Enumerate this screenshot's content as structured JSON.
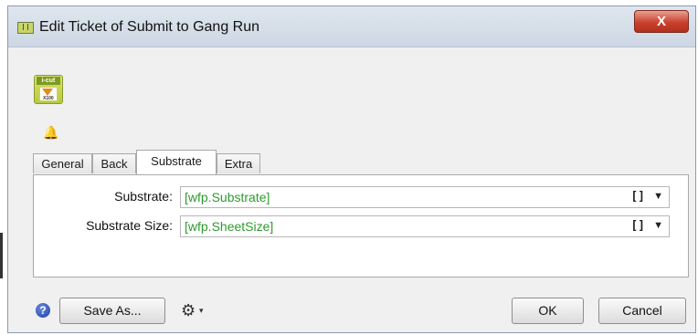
{
  "window": {
    "title": "Edit Ticket of Submit to Gang Run",
    "close_label": "X"
  },
  "app_icon": {
    "name": "i-cut-x100-icon",
    "top_text": "i-cut",
    "bottom_text": "X100"
  },
  "bell": {
    "name": "bell-icon",
    "glyph": "🔔"
  },
  "tabs": [
    {
      "label": "General",
      "active": false
    },
    {
      "label": "Back",
      "active": false
    },
    {
      "label": "Substrate",
      "active": true
    },
    {
      "label": "Extra",
      "active": false
    }
  ],
  "fields": [
    {
      "label": "Substrate:",
      "value": "[wfp.Substrate]",
      "brackets": "[]",
      "arrow": "▼"
    },
    {
      "label": "Substrate Size:",
      "value": "[wfp.SheetSize]",
      "brackets": "[]",
      "arrow": "▼"
    }
  ],
  "footer": {
    "help_glyph": "?",
    "save_as_label": "Save As...",
    "gear_glyph": "⚙",
    "gear_arrow": "▾",
    "ok_label": "OK",
    "cancel_label": "Cancel"
  },
  "colors": {
    "value_text": "#2e9b2e",
    "close_button": "#c8412d"
  }
}
